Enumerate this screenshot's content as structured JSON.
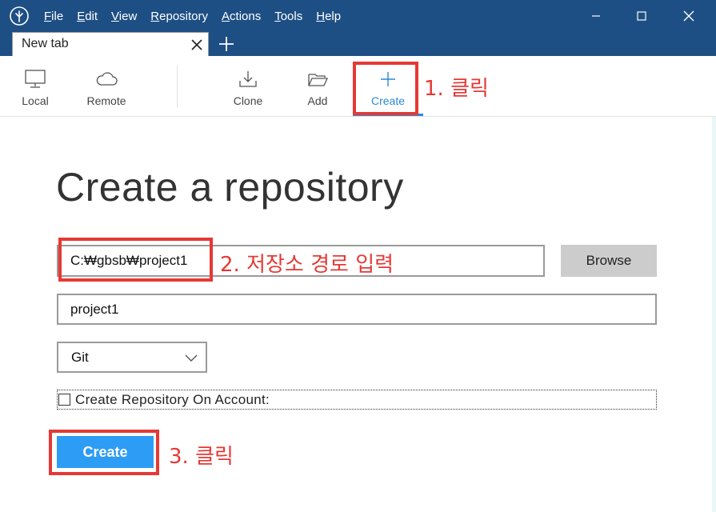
{
  "menu": {
    "items": [
      {
        "label": "File",
        "mnemonic": "F",
        "rest": "ile"
      },
      {
        "label": "Edit",
        "mnemonic": "E",
        "rest": "dit"
      },
      {
        "label": "View",
        "mnemonic": "V",
        "rest": "iew"
      },
      {
        "label": "Repository",
        "mnemonic": "R",
        "rest": "epository"
      },
      {
        "label": "Actions",
        "mnemonic": "A",
        "rest": "ctions"
      },
      {
        "label": "Tools",
        "mnemonic": "T",
        "rest": "ools"
      },
      {
        "label": "Help",
        "mnemonic": "H",
        "rest": "elp"
      }
    ]
  },
  "tabs": {
    "active_label": "New tab"
  },
  "toolbar": {
    "local_label": "Local",
    "remote_label": "Remote",
    "clone_label": "Clone",
    "add_label": "Add",
    "create_label": "Create"
  },
  "main": {
    "title": "Create a repository",
    "path_value": "C:₩gbsb₩project1",
    "browse_label": "Browse",
    "name_value": "project1",
    "repo_type_value": "Git",
    "account_label": "Create Repository On Account:",
    "create_button_label": "Create"
  },
  "annotations": {
    "step1": "1. 클릭",
    "step2": "2. 저장소 경로 입력",
    "step3": "3. 클릭"
  },
  "colors": {
    "titlebar": "#1e4f84",
    "accent": "#2a8ad8",
    "create_button": "#2d9cf5",
    "annotation": "#e53935"
  }
}
